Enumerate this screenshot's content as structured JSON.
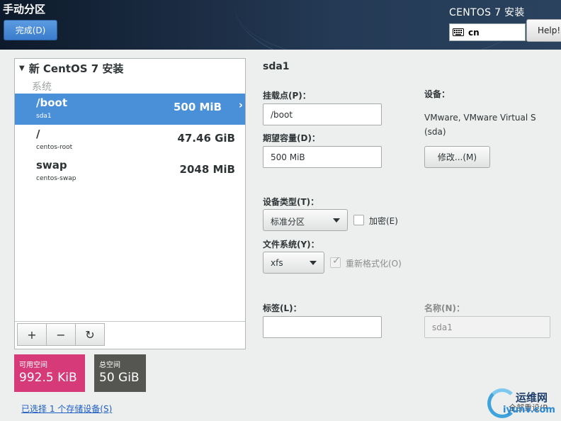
{
  "header": {
    "spoke_title": "手动分区",
    "done_label": "完成(D)",
    "install_title": "CENTOS 7 安装",
    "keyboard_layout": "cn",
    "help_label": "Help!"
  },
  "left_panel": {
    "installation_title": "新 CentOS 7 安装",
    "category_label": "系统",
    "mount_points": [
      {
        "mount_point": "/boot",
        "device": "sda1",
        "size": "500 MiB",
        "selected": true
      },
      {
        "mount_point": "/",
        "device": "centos-root",
        "size": "47.46 GiB",
        "selected": false
      },
      {
        "mount_point": "swap",
        "device": "centos-swap",
        "size": "2048 MiB",
        "selected": false
      }
    ],
    "toolbar": {
      "add_icon": "plus-icon",
      "remove_icon": "minus-icon",
      "refresh_icon": "refresh-icon"
    }
  },
  "space": {
    "available_label": "可用空间",
    "available_value": "992.5 KiB",
    "total_label": "总空间",
    "total_value": "50 GiB",
    "available_color": "#d63a79",
    "total_color": "#555652"
  },
  "selected_devices_link": "已选择 1 个存储设备(S)",
  "detail": {
    "title": "sda1",
    "mount_point_label": "挂载点(P)：",
    "mount_point_value": "/boot",
    "desired_capacity_label": "期望容量(D)：",
    "desired_capacity_value": "500 MiB",
    "device_label": "设备：",
    "device_value_line1": "VMware, VMware Virtual S",
    "device_value_line2": "(sda)",
    "modify_label": "修改...(M)",
    "device_type_label": "设备类型(T)：",
    "device_type_value": "标准分区",
    "encrypt_label": "加密(E)",
    "encrypt_checked": false,
    "filesystem_label": "文件系统(Y)：",
    "filesystem_value": "xfs",
    "reformat_label": "重新格式化(O)",
    "reformat_checked": true,
    "label_label": "标签(L)：",
    "label_value": "",
    "name_label": "名称(N)：",
    "name_value": "sda1"
  },
  "watermark": {
    "cn_text": "运维网",
    "url_text": "iyunv.com",
    "partial_button_text": "全部重设(R"
  },
  "colors": {
    "accent": "#4a90d9",
    "header_dark": "#0d1a2b",
    "link": "#1d5fc4"
  }
}
